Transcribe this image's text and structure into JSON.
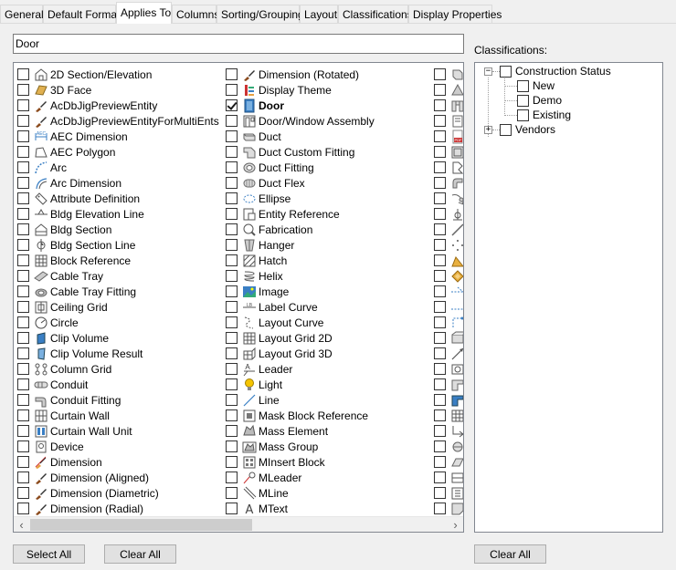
{
  "tabs": [
    {
      "label": "General",
      "active": false
    },
    {
      "label": "Default Format",
      "active": false
    },
    {
      "label": "Applies To",
      "active": true
    },
    {
      "label": "Columns",
      "active": false
    },
    {
      "label": "Sorting/Grouping",
      "active": false
    },
    {
      "label": "Layout",
      "active": false
    },
    {
      "label": "Classifications",
      "active": false
    },
    {
      "label": "Display Properties",
      "active": false
    }
  ],
  "filter": {
    "value": "Door"
  },
  "applies_to": {
    "column1": [
      {
        "label": "2D Section/Elevation",
        "icon": "section-elevation-icon",
        "checked": false
      },
      {
        "label": "3D Face",
        "icon": "face-icon",
        "checked": false
      },
      {
        "label": "AcDbJigPreviewEntity",
        "icon": "brush-icon",
        "checked": false
      },
      {
        "label": "AcDbJigPreviewEntityForMultiEnts",
        "icon": "brush-icon",
        "checked": false
      },
      {
        "label": "AEC Dimension",
        "icon": "aec-dimension-icon",
        "checked": false
      },
      {
        "label": "AEC Polygon",
        "icon": "polygon-icon",
        "checked": false
      },
      {
        "label": "Arc",
        "icon": "arc-icon",
        "checked": false
      },
      {
        "label": "Arc Dimension",
        "icon": "arc-dimension-icon",
        "checked": false
      },
      {
        "label": "Attribute Definition",
        "icon": "tag-icon",
        "checked": false
      },
      {
        "label": "Bldg Elevation Line",
        "icon": "elevation-line-icon",
        "checked": false
      },
      {
        "label": "Bldg Section",
        "icon": "bldg-section-icon",
        "checked": false
      },
      {
        "label": "Bldg Section Line",
        "icon": "section-line-icon",
        "checked": false
      },
      {
        "label": "Block Reference",
        "icon": "block-icon",
        "checked": false
      },
      {
        "label": "Cable Tray",
        "icon": "cable-tray-icon",
        "checked": false
      },
      {
        "label": "Cable Tray Fitting",
        "icon": "cable-tray-fitting-icon",
        "checked": false
      },
      {
        "label": "Ceiling Grid",
        "icon": "ceiling-grid-icon",
        "checked": false
      },
      {
        "label": "Circle",
        "icon": "circle-icon",
        "checked": false
      },
      {
        "label": "Clip Volume",
        "icon": "clip-volume-icon",
        "checked": false
      },
      {
        "label": "Clip Volume Result",
        "icon": "clip-volume-result-icon",
        "checked": false
      },
      {
        "label": "Column Grid",
        "icon": "column-grid-icon",
        "checked": false
      },
      {
        "label": "Conduit",
        "icon": "conduit-icon",
        "checked": false
      },
      {
        "label": "Conduit Fitting",
        "icon": "conduit-fitting-icon",
        "checked": false
      },
      {
        "label": "Curtain Wall",
        "icon": "curtain-wall-icon",
        "checked": false
      },
      {
        "label": "Curtain Wall Unit",
        "icon": "curtain-wall-unit-icon",
        "checked": false
      },
      {
        "label": "Device",
        "icon": "device-icon",
        "checked": false
      },
      {
        "label": "Dimension",
        "icon": "dimension-icon",
        "checked": false
      },
      {
        "label": "Dimension (Aligned)",
        "icon": "brush-icon",
        "checked": false
      },
      {
        "label": "Dimension (Diametric)",
        "icon": "brush-icon",
        "checked": false
      },
      {
        "label": "Dimension (Radial)",
        "icon": "brush-icon",
        "checked": false
      }
    ],
    "column2": [
      {
        "label": "Dimension (Rotated)",
        "icon": "brush-icon",
        "checked": false,
        "bold": false
      },
      {
        "label": "Display Theme",
        "icon": "display-theme-icon",
        "checked": false,
        "bold": false
      },
      {
        "label": "Door",
        "icon": "door-icon",
        "checked": true,
        "bold": true
      },
      {
        "label": "Door/Window Assembly",
        "icon": "door-window-assembly-icon",
        "checked": false,
        "bold": false
      },
      {
        "label": "Duct",
        "icon": "duct-icon",
        "checked": false,
        "bold": false
      },
      {
        "label": "Duct Custom Fitting",
        "icon": "duct-custom-fitting-icon",
        "checked": false,
        "bold": false
      },
      {
        "label": "Duct Fitting",
        "icon": "duct-fitting-icon",
        "checked": false,
        "bold": false
      },
      {
        "label": "Duct Flex",
        "icon": "duct-flex-icon",
        "checked": false,
        "bold": false
      },
      {
        "label": "Ellipse",
        "icon": "ellipse-icon",
        "checked": false,
        "bold": false
      },
      {
        "label": "Entity Reference",
        "icon": "entity-reference-icon",
        "checked": false,
        "bold": false
      },
      {
        "label": "Fabrication",
        "icon": "fabrication-icon",
        "checked": false,
        "bold": false
      },
      {
        "label": "Hanger",
        "icon": "hanger-icon",
        "checked": false,
        "bold": false
      },
      {
        "label": "Hatch",
        "icon": "hatch-icon",
        "checked": false,
        "bold": false
      },
      {
        "label": "Helix",
        "icon": "helix-icon",
        "checked": false,
        "bold": false
      },
      {
        "label": "Image",
        "icon": "image-icon",
        "checked": false,
        "bold": false
      },
      {
        "label": "Label Curve",
        "icon": "label-curve-icon",
        "checked": false,
        "bold": false
      },
      {
        "label": "Layout Curve",
        "icon": "layout-curve-icon",
        "checked": false,
        "bold": false
      },
      {
        "label": "Layout Grid 2D",
        "icon": "layout-grid-2d-icon",
        "checked": false,
        "bold": false
      },
      {
        "label": "Layout Grid 3D",
        "icon": "layout-grid-3d-icon",
        "checked": false,
        "bold": false
      },
      {
        "label": "Leader",
        "icon": "leader-icon",
        "checked": false,
        "bold": false
      },
      {
        "label": "Light",
        "icon": "light-icon",
        "checked": false,
        "bold": false
      },
      {
        "label": "Line",
        "icon": "line-icon",
        "checked": false,
        "bold": false
      },
      {
        "label": "Mask Block Reference",
        "icon": "mask-block-icon",
        "checked": false,
        "bold": false
      },
      {
        "label": "Mass Element",
        "icon": "mass-element-icon",
        "checked": false,
        "bold": false
      },
      {
        "label": "Mass Group",
        "icon": "mass-group-icon",
        "checked": false,
        "bold": false
      },
      {
        "label": "MInsert Block",
        "icon": "minsert-block-icon",
        "checked": false,
        "bold": false
      },
      {
        "label": "MLeader",
        "icon": "mleader-icon",
        "checked": false,
        "bold": false
      },
      {
        "label": "MLine",
        "icon": "mline-icon",
        "checked": false,
        "bold": false
      },
      {
        "label": "MText",
        "icon": "mtext-icon",
        "checked": false,
        "bold": false
      }
    ],
    "column3_icons": [
      "column3-item-icon-1",
      "column3-item-icon-2",
      "column3-item-icon-3",
      "column3-item-icon-4",
      "column3-item-icon-5",
      "column3-item-icon-6",
      "column3-item-icon-7",
      "column3-item-icon-8",
      "column3-item-icon-9",
      "column3-item-icon-10",
      "column3-item-icon-11",
      "column3-item-icon-12",
      "column3-item-icon-13",
      "column3-item-icon-14",
      "column3-item-icon-15",
      "column3-item-icon-16",
      "column3-item-icon-17",
      "column3-item-icon-18",
      "column3-item-icon-19",
      "column3-item-icon-20",
      "column3-item-icon-21",
      "column3-item-icon-22",
      "column3-item-icon-23",
      "column3-item-icon-24",
      "column3-item-icon-25",
      "column3-item-icon-26",
      "column3-item-icon-27",
      "column3-item-icon-28",
      "column3-item-icon-29"
    ]
  },
  "classifications": {
    "label": "Classifications:",
    "tree": [
      {
        "label": "Construction Status",
        "expanded": true,
        "children": [
          "New",
          "Demo",
          "Existing"
        ]
      },
      {
        "label": "Vendors",
        "expanded": false,
        "children": []
      }
    ]
  },
  "buttons": {
    "select_all": "Select All",
    "clear_all_left": "Clear All",
    "clear_all_right": "Clear All"
  },
  "colors": {
    "checkmark": "#1a1a1a",
    "brush_handle": "#8b4a1c",
    "icon_gray": "#6b6b6b",
    "icon_blue": "#3a7fc4"
  }
}
